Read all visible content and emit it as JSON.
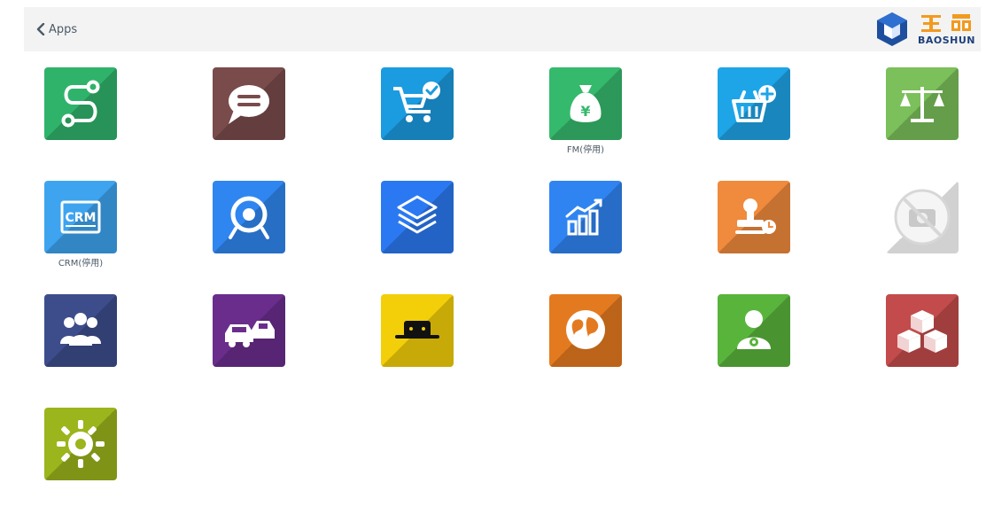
{
  "header": {
    "back_label": "Apps",
    "brand": {
      "name_en": "BAOSHUN",
      "name_cn": "宝舜"
    }
  },
  "apps": [
    {
      "label": "",
      "color": "#2fb36b",
      "icon": "route-s-icon"
    },
    {
      "label": "",
      "color": "#7a4b4b",
      "icon": "chat-bubble-icon"
    },
    {
      "label": "",
      "color": "#1b9be0",
      "icon": "cart-check-icon"
    },
    {
      "label": "FM(停用)",
      "color": "#35b96d",
      "icon": "money-bag-icon"
    },
    {
      "label": "",
      "color": "#1ea5e8",
      "icon": "basket-plus-icon"
    },
    {
      "label": "",
      "color": "#7bc05a",
      "icon": "scales-icon"
    },
    {
      "label": "CRM(停用)",
      "color": "#3ea4ef",
      "icon": "crm-icon"
    },
    {
      "label": "",
      "color": "#2f86f0",
      "icon": "target-icon"
    },
    {
      "label": "",
      "color": "#2b79f2",
      "icon": "layers-icon"
    },
    {
      "label": "",
      "color": "#2f84f2",
      "icon": "bar-chart-icon"
    },
    {
      "label": "",
      "color": "#f08a3c",
      "icon": "stamp-clock-icon"
    },
    {
      "label": "",
      "color": "#ffffff",
      "icon": "no-camera-icon"
    },
    {
      "label": "",
      "color": "#3d4d8c",
      "icon": "group-icon"
    },
    {
      "label": "",
      "color": "#6a2d8c",
      "icon": "cars-icon"
    },
    {
      "label": "",
      "color": "#f3cf0a",
      "icon": "robot-icon"
    },
    {
      "label": "",
      "color": "#e47a1f",
      "icon": "globe-icon"
    },
    {
      "label": "",
      "color": "#59b43c",
      "icon": "user-gear-icon"
    },
    {
      "label": "",
      "color": "#c34b4b",
      "icon": "cubes-icon"
    },
    {
      "label": "",
      "color": "#9bb51c",
      "icon": "gear-icon"
    }
  ]
}
